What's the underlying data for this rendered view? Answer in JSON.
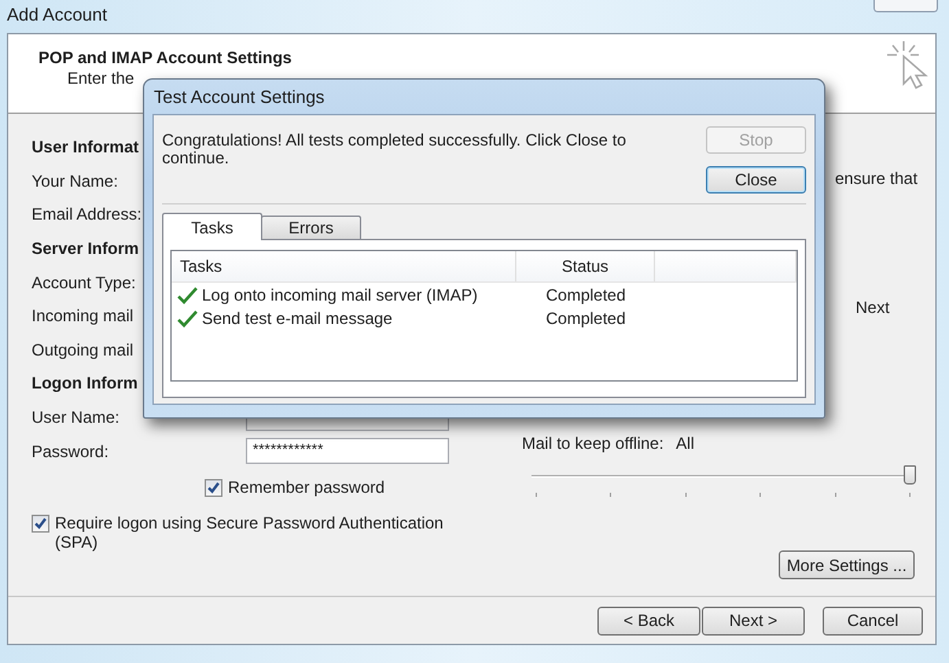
{
  "window": {
    "title": "Add Account"
  },
  "header": {
    "title": "POP and IMAP Account Settings",
    "subtitle": "Enter the"
  },
  "form_rows": [
    {
      "kind": "heading",
      "text": "User Informat"
    },
    {
      "kind": "label",
      "text": "Your Name:"
    },
    {
      "kind": "label",
      "text": "Email Address:"
    },
    {
      "kind": "heading",
      "text": "Server Inform"
    },
    {
      "kind": "label",
      "text": "Account Type:"
    },
    {
      "kind": "label",
      "text": "Incoming mail"
    },
    {
      "kind": "label",
      "text": "Outgoing mail"
    },
    {
      "kind": "heading",
      "text": "Logon Inform"
    },
    {
      "kind": "field",
      "text": "User Name:"
    },
    {
      "kind": "field",
      "text": "Password:",
      "value": "************"
    }
  ],
  "checkboxes": [
    {
      "label": "Remember password",
      "checked": true
    },
    {
      "label": "Require logon using Secure Password Authentication (SPA)",
      "checked": true
    }
  ],
  "right_texts": [
    "ensure that",
    "Next"
  ],
  "offline": {
    "label": "Mail to keep offline:",
    "value": "All",
    "level": 1
  },
  "more_settings": "More Settings ...",
  "footer_buttons": [
    "< Back",
    "Next >",
    "Cancel"
  ],
  "dialog": {
    "title": "Test Account Settings",
    "message": "Congratulations! All tests completed successfully. Click Close to continue.",
    "buttons": [
      {
        "label": "Stop",
        "disabled": true
      },
      {
        "label": "Close",
        "disabled": false
      }
    ],
    "tabs": [
      {
        "label": "Tasks",
        "selected": true
      },
      {
        "label": "Errors",
        "selected": false
      }
    ],
    "columns": [
      "Tasks",
      "Status"
    ],
    "rows": [
      {
        "task": "Log onto incoming mail server (IMAP)",
        "status": "Completed"
      },
      {
        "task": "Send test e-mail message",
        "status": "Completed"
      }
    ]
  }
}
